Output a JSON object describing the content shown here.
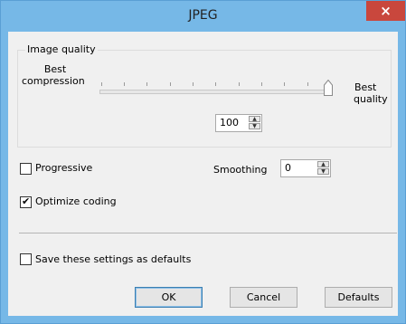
{
  "window": {
    "title": "JPEG",
    "close_glyph": "×"
  },
  "quality_group": {
    "label": "Image quality",
    "left_label_line1": "Best",
    "left_label_line2": "compression",
    "right_label_line1": "Best",
    "right_label_line2": "quality",
    "slider_value_fraction": 1.0,
    "value": "100"
  },
  "options": {
    "progressive": {
      "label": "Progressive",
      "checked": false
    },
    "optimize": {
      "label": "Optimize coding",
      "checked": true
    },
    "smoothing": {
      "label": "Smoothing",
      "value": "0"
    },
    "save_defaults": {
      "label": "Save these settings as defaults",
      "checked": false
    }
  },
  "buttons": {
    "ok": "OK",
    "cancel": "Cancel",
    "defaults": "Defaults"
  },
  "icons": {
    "checkmark": "check-icon",
    "close": "close-icon"
  }
}
